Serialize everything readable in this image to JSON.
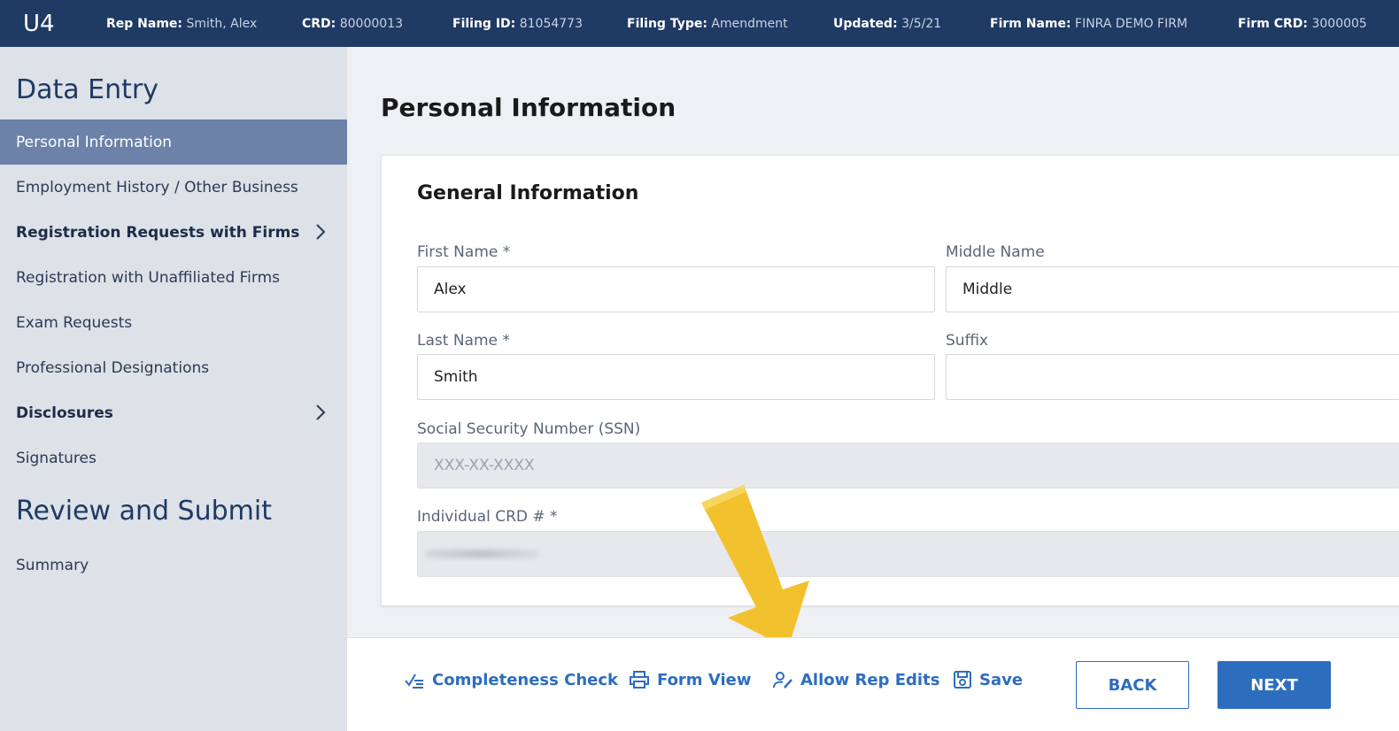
{
  "header": {
    "app": "U4",
    "fields": [
      {
        "label": "Rep Name:",
        "value": "Smith, Alex"
      },
      {
        "label": "CRD:",
        "value": "80000013"
      },
      {
        "label": "Filing ID:",
        "value": "81054773"
      },
      {
        "label": "Filing Type:",
        "value": "Amendment"
      },
      {
        "label": "Updated:",
        "value": "3/5/21"
      },
      {
        "label": "Firm Name:",
        "value": "FINRA DEMO FIRM"
      },
      {
        "label": "Firm CRD:",
        "value": "3000005"
      }
    ]
  },
  "sidebar": {
    "section1": "Data Entry",
    "items": [
      {
        "label": "Personal Information"
      },
      {
        "label": "Employment History / Other Business"
      },
      {
        "label": "Registration Requests with Firms"
      },
      {
        "label": "Registration with Unaffiliated Firms"
      },
      {
        "label": "Exam Requests"
      },
      {
        "label": "Professional Designations"
      },
      {
        "label": "Disclosures"
      },
      {
        "label": "Signatures"
      }
    ],
    "section2": "Review and Submit",
    "items2": [
      {
        "label": "Summary"
      }
    ]
  },
  "main": {
    "title": "Personal Information",
    "card_title": "General Information",
    "first_name": {
      "label": "First Name *",
      "value": "Alex"
    },
    "middle_name": {
      "label": "Middle Name",
      "value": "Middle"
    },
    "last_name": {
      "label": "Last Name *",
      "value": "Smith"
    },
    "suffix": {
      "label": "Suffix",
      "value": ""
    },
    "ssn": {
      "label": "Social Security Number (SSN)",
      "value": "XXX-XX-XXXX"
    },
    "crd": {
      "label": "Individual CRD # *"
    }
  },
  "footer": {
    "completeness": "Completeness Check",
    "form_view": "Form View",
    "allow_edits": "Allow Rep Edits",
    "save": "Save",
    "back": "BACK",
    "next": "NEXT"
  },
  "colors": {
    "header": "#1f3a63",
    "sidebar": "#dde1e8",
    "active": "#6c82a8",
    "accent": "#2d6dbe",
    "arrow": "#f2c12e"
  },
  "icons": [
    "checklist-icon",
    "printer-icon",
    "user-edit-icon",
    "save-icon",
    "chevron-right-icon"
  ]
}
